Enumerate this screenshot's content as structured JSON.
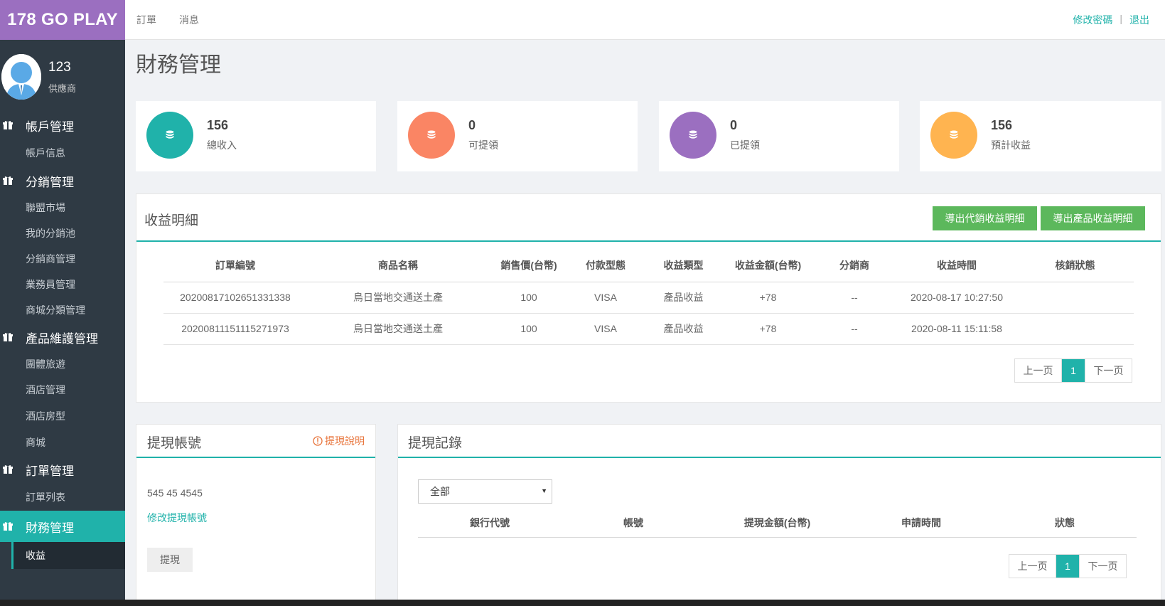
{
  "brand": "178 GO PLAY",
  "profile": {
    "name": "123",
    "role": "供應商"
  },
  "sidebar": {
    "groups": [
      {
        "label": "帳戶管理",
        "items": [
          "帳戶信息"
        ]
      },
      {
        "label": "分銷管理",
        "items": [
          "聯盟市場",
          "我的分銷池",
          "分銷商管理",
          "業務員管理",
          "商城分類管理"
        ]
      },
      {
        "label": "產品維護管理",
        "items": [
          "團體旅遊",
          "酒店管理",
          "酒店房型",
          "商城"
        ]
      },
      {
        "label": "訂單管理",
        "items": [
          "訂單列表"
        ]
      },
      {
        "label": "財務管理",
        "items": [
          "收益"
        ]
      }
    ]
  },
  "topnav": {
    "orders": "訂單",
    "messages": "消息",
    "change_password": "修改密碼",
    "separator": "|",
    "logout": "退出"
  },
  "page_title": "財務管理",
  "stats": [
    {
      "value": "156",
      "label": "總收入",
      "color": "#20b2aa"
    },
    {
      "value": "0",
      "label": "可提領",
      "color": "#fa8564"
    },
    {
      "value": "0",
      "label": "已提領",
      "color": "#9b6fc0"
    },
    {
      "value": "156",
      "label": "預計收益",
      "color": "#ffb450"
    }
  ],
  "earnings": {
    "title": "收益明細",
    "export_agent_label": "導出代銷收益明細",
    "export_product_label": "導出產品收益明細",
    "columns": [
      "訂單編號",
      "商品名稱",
      "銷售價(台幣)",
      "付款型態",
      "收益類型",
      "收益金額(台幣)",
      "分銷商",
      "收益時間",
      "核銷狀態"
    ],
    "rows": [
      [
        "20200817102651331338",
        "烏日當地交通送土產",
        "100",
        "VISA",
        "產品收益",
        "+78",
        "--",
        "2020-08-17 10:27:50",
        ""
      ],
      [
        "20200811151115271973",
        "烏日當地交通送土產",
        "100",
        "VISA",
        "產品收益",
        "+78",
        "--",
        "2020-08-11 15:11:58",
        ""
      ]
    ],
    "pager": {
      "prev": "上一页",
      "current": "1",
      "next": "下一页"
    }
  },
  "withdraw_account": {
    "title": "提現帳號",
    "note": "提現說明",
    "account": "545 45 4545",
    "edit_link": "修改提現帳號",
    "withdraw_button": "提現"
  },
  "withdraw_records": {
    "title": "提現記錄",
    "filter_value": "全部",
    "columns": [
      "銀行代號",
      "帳號",
      "提現金額(台幣)",
      "申請時間",
      "狀態"
    ],
    "pager": {
      "prev": "上一页",
      "current": "1",
      "next": "下一页"
    }
  }
}
